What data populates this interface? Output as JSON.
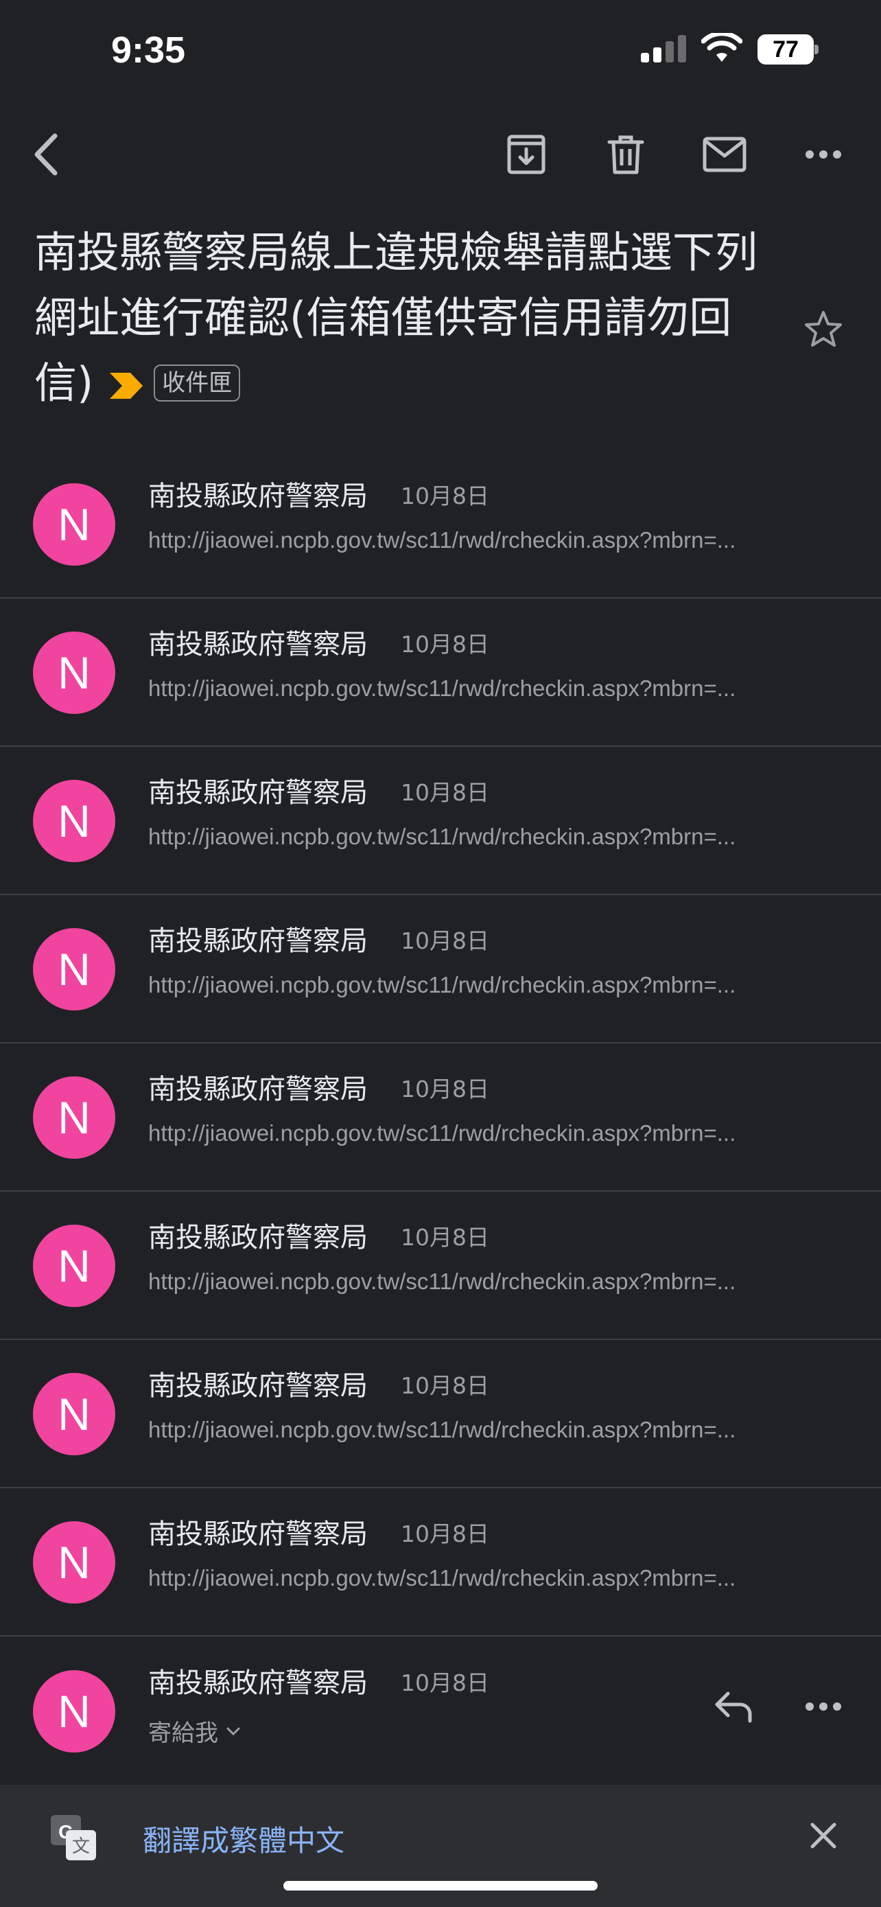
{
  "status_bar": {
    "time": "9:35",
    "battery": "77",
    "icons": [
      "signal-icon",
      "wifi-icon",
      "battery-icon"
    ]
  },
  "toolbar": {
    "icons": [
      "back-arrow-icon",
      "archive-icon",
      "trash-icon",
      "mail-icon",
      "more-horizontal-icon"
    ]
  },
  "email": {
    "subject": "南投縣警察局線上違規檢舉請點選下列網址進行確認(信箱僅供寄信用請勿回信)",
    "label": "收件匣",
    "importance_color": "#f9ab00"
  },
  "messages": [
    {
      "avatar": "N",
      "sender": "南投縣政府警察局",
      "date": "10月8日",
      "snippet": "http://jiaowei.ncpb.gov.tw/sc11/rwd/rcheckin.aspx?mbrn=..."
    },
    {
      "avatar": "N",
      "sender": "南投縣政府警察局",
      "date": "10月8日",
      "snippet": "http://jiaowei.ncpb.gov.tw/sc11/rwd/rcheckin.aspx?mbrn=..."
    },
    {
      "avatar": "N",
      "sender": "南投縣政府警察局",
      "date": "10月8日",
      "snippet": "http://jiaowei.ncpb.gov.tw/sc11/rwd/rcheckin.aspx?mbrn=..."
    },
    {
      "avatar": "N",
      "sender": "南投縣政府警察局",
      "date": "10月8日",
      "snippet": "http://jiaowei.ncpb.gov.tw/sc11/rwd/rcheckin.aspx?mbrn=..."
    },
    {
      "avatar": "N",
      "sender": "南投縣政府警察局",
      "date": "10月8日",
      "snippet": "http://jiaowei.ncpb.gov.tw/sc11/rwd/rcheckin.aspx?mbrn=..."
    },
    {
      "avatar": "N",
      "sender": "南投縣政府警察局",
      "date": "10月8日",
      "snippet": "http://jiaowei.ncpb.gov.tw/sc11/rwd/rcheckin.aspx?mbrn=..."
    },
    {
      "avatar": "N",
      "sender": "南投縣政府警察局",
      "date": "10月8日",
      "snippet": "http://jiaowei.ncpb.gov.tw/sc11/rwd/rcheckin.aspx?mbrn=..."
    },
    {
      "avatar": "N",
      "sender": "南投縣政府警察局",
      "date": "10月8日",
      "snippet": "http://jiaowei.ncpb.gov.tw/sc11/rwd/rcheckin.aspx?mbrn=..."
    }
  ],
  "last_message": {
    "avatar": "N",
    "sender": "南投縣政府警察局",
    "date": "10月8日",
    "recipient": "寄給我"
  },
  "translate_bar": {
    "text": "翻譯成繁體中文"
  },
  "colors": {
    "background": "#202124",
    "avatar": "#f0449f",
    "link": "#8ab4f8"
  }
}
